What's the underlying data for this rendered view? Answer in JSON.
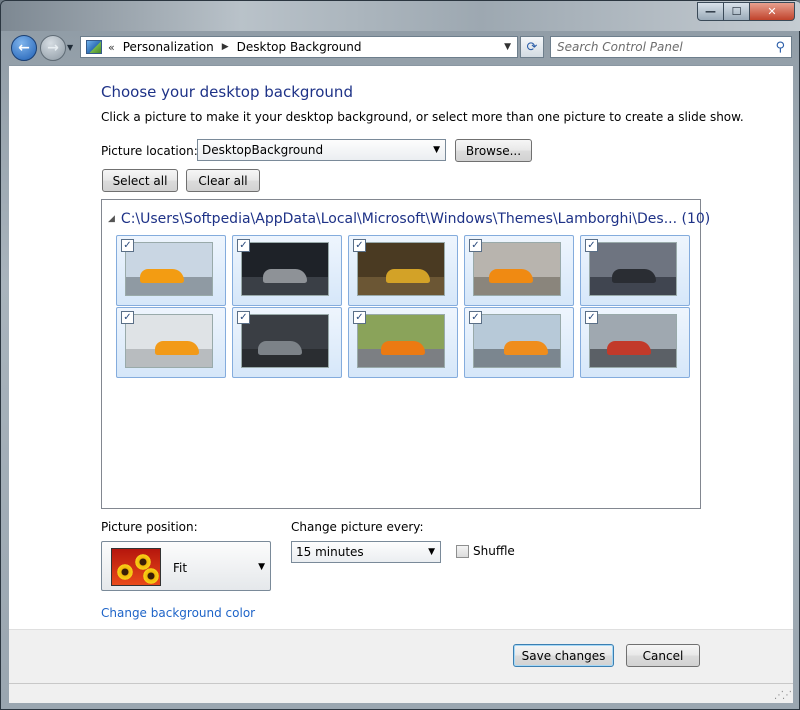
{
  "window": {
    "caption_minimize": "—",
    "caption_maximize": "☐",
    "caption_close": "✕"
  },
  "navbar": {
    "back_glyph": "←",
    "forward_glyph": "→",
    "history_glyph": "▼",
    "address_overflow": "«",
    "breadcrumbs": [
      "Personalization",
      "Desktop Background"
    ],
    "crumb_separator": "▶",
    "address_dropdown_glyph": "▼",
    "refresh_glyph": "⟳",
    "search_placeholder": "Search Control Panel",
    "search_glyph": "⚲"
  },
  "page": {
    "heading": "Choose your desktop background",
    "subtext": "Click a picture to make it your desktop background, or select more than one picture to create a slide show.",
    "picture_location_label": "Picture location:",
    "picture_location_value": "DesktopBackground",
    "browse_button": "Browse...",
    "select_all_button": "Select all",
    "clear_all_button": "Clear all",
    "dropdown_glyph": "▼"
  },
  "gallery": {
    "group_toggle_glyph": "◢",
    "group_path": "C:\\Users\\Softpedia\\AppData\\Local\\Microsoft\\Windows\\Themes\\Lamborghi\\Des... (10)",
    "check_glyph": "✓",
    "pictures": [
      {
        "checked": true,
        "car": "#f39c12",
        "sky": "#c9d6e3",
        "ground": "#8f9aa3"
      },
      {
        "checked": true,
        "car": "#8e9297",
        "sky": "#1e2228",
        "ground": "#3a3f46"
      },
      {
        "checked": true,
        "car": "#d3a227",
        "sky": "#4a3a22",
        "ground": "#6b5634"
      },
      {
        "checked": true,
        "car": "#f08a12",
        "sky": "#b8b4ae",
        "ground": "#8a857c"
      },
      {
        "checked": true,
        "car": "#2a2d33",
        "sky": "#6e7480",
        "ground": "#404550"
      },
      {
        "checked": true,
        "car": "#f29a18",
        "sky": "#dfe3e6",
        "ground": "#b8bcbf"
      },
      {
        "checked": true,
        "car": "#7c8288",
        "sky": "#3a3e44",
        "ground": "#2a2d31"
      },
      {
        "checked": true,
        "car": "#ec7a12",
        "sky": "#8aa35a",
        "ground": "#7c7f83"
      },
      {
        "checked": true,
        "car": "#ef8d1c",
        "sky": "#b7c9d8",
        "ground": "#7b868f"
      },
      {
        "checked": true,
        "car": "#c23a2a",
        "sky": "#9fa8b0",
        "ground": "#5b6066"
      }
    ]
  },
  "options": {
    "picture_position_label": "Picture position:",
    "picture_position_value": "Fit",
    "change_every_label": "Change picture every:",
    "change_every_value": "15 minutes",
    "shuffle_label": "Shuffle",
    "shuffle_checked": false,
    "change_color_link": "Change background color"
  },
  "footer": {
    "save_button": "Save changes",
    "cancel_button": "Cancel"
  }
}
